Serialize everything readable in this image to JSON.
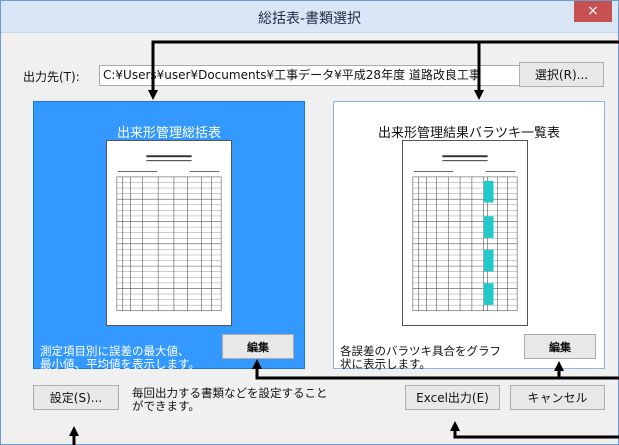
{
  "window": {
    "title": "総括表-書類選択",
    "close_glyph": "×"
  },
  "output": {
    "label": "出力先(T):",
    "path": "C:¥Users¥user¥Documents¥工事データ¥平成28年度 道路改良工事",
    "select_button": "選択(R)..."
  },
  "cards": [
    {
      "title": "出来形管理総括表",
      "desc_line1": "測定項目別に誤差の最大値、",
      "desc_line2": "最小値、平均値を表示します。",
      "edit_button": "編集",
      "selected": true
    },
    {
      "title": "出来形管理結果バラツキ一覧表",
      "desc_line1": "各誤差のバラツキ具合をグラフ",
      "desc_line2": "状に表示します。",
      "edit_button": "編集",
      "selected": false
    }
  ],
  "footer": {
    "settings_button": "設定(S)...",
    "settings_desc_line1": "毎回出力する書類などを設定すること",
    "settings_desc_line2": "ができます。",
    "excel_button": "Excel出力(E)",
    "cancel_button": "キャンセル"
  },
  "colors": {
    "selected_card": "#3399ff",
    "title_bar": "#d9e6f6",
    "close_button": "#c75050",
    "thumbnail_accent": "#22c9c9"
  }
}
